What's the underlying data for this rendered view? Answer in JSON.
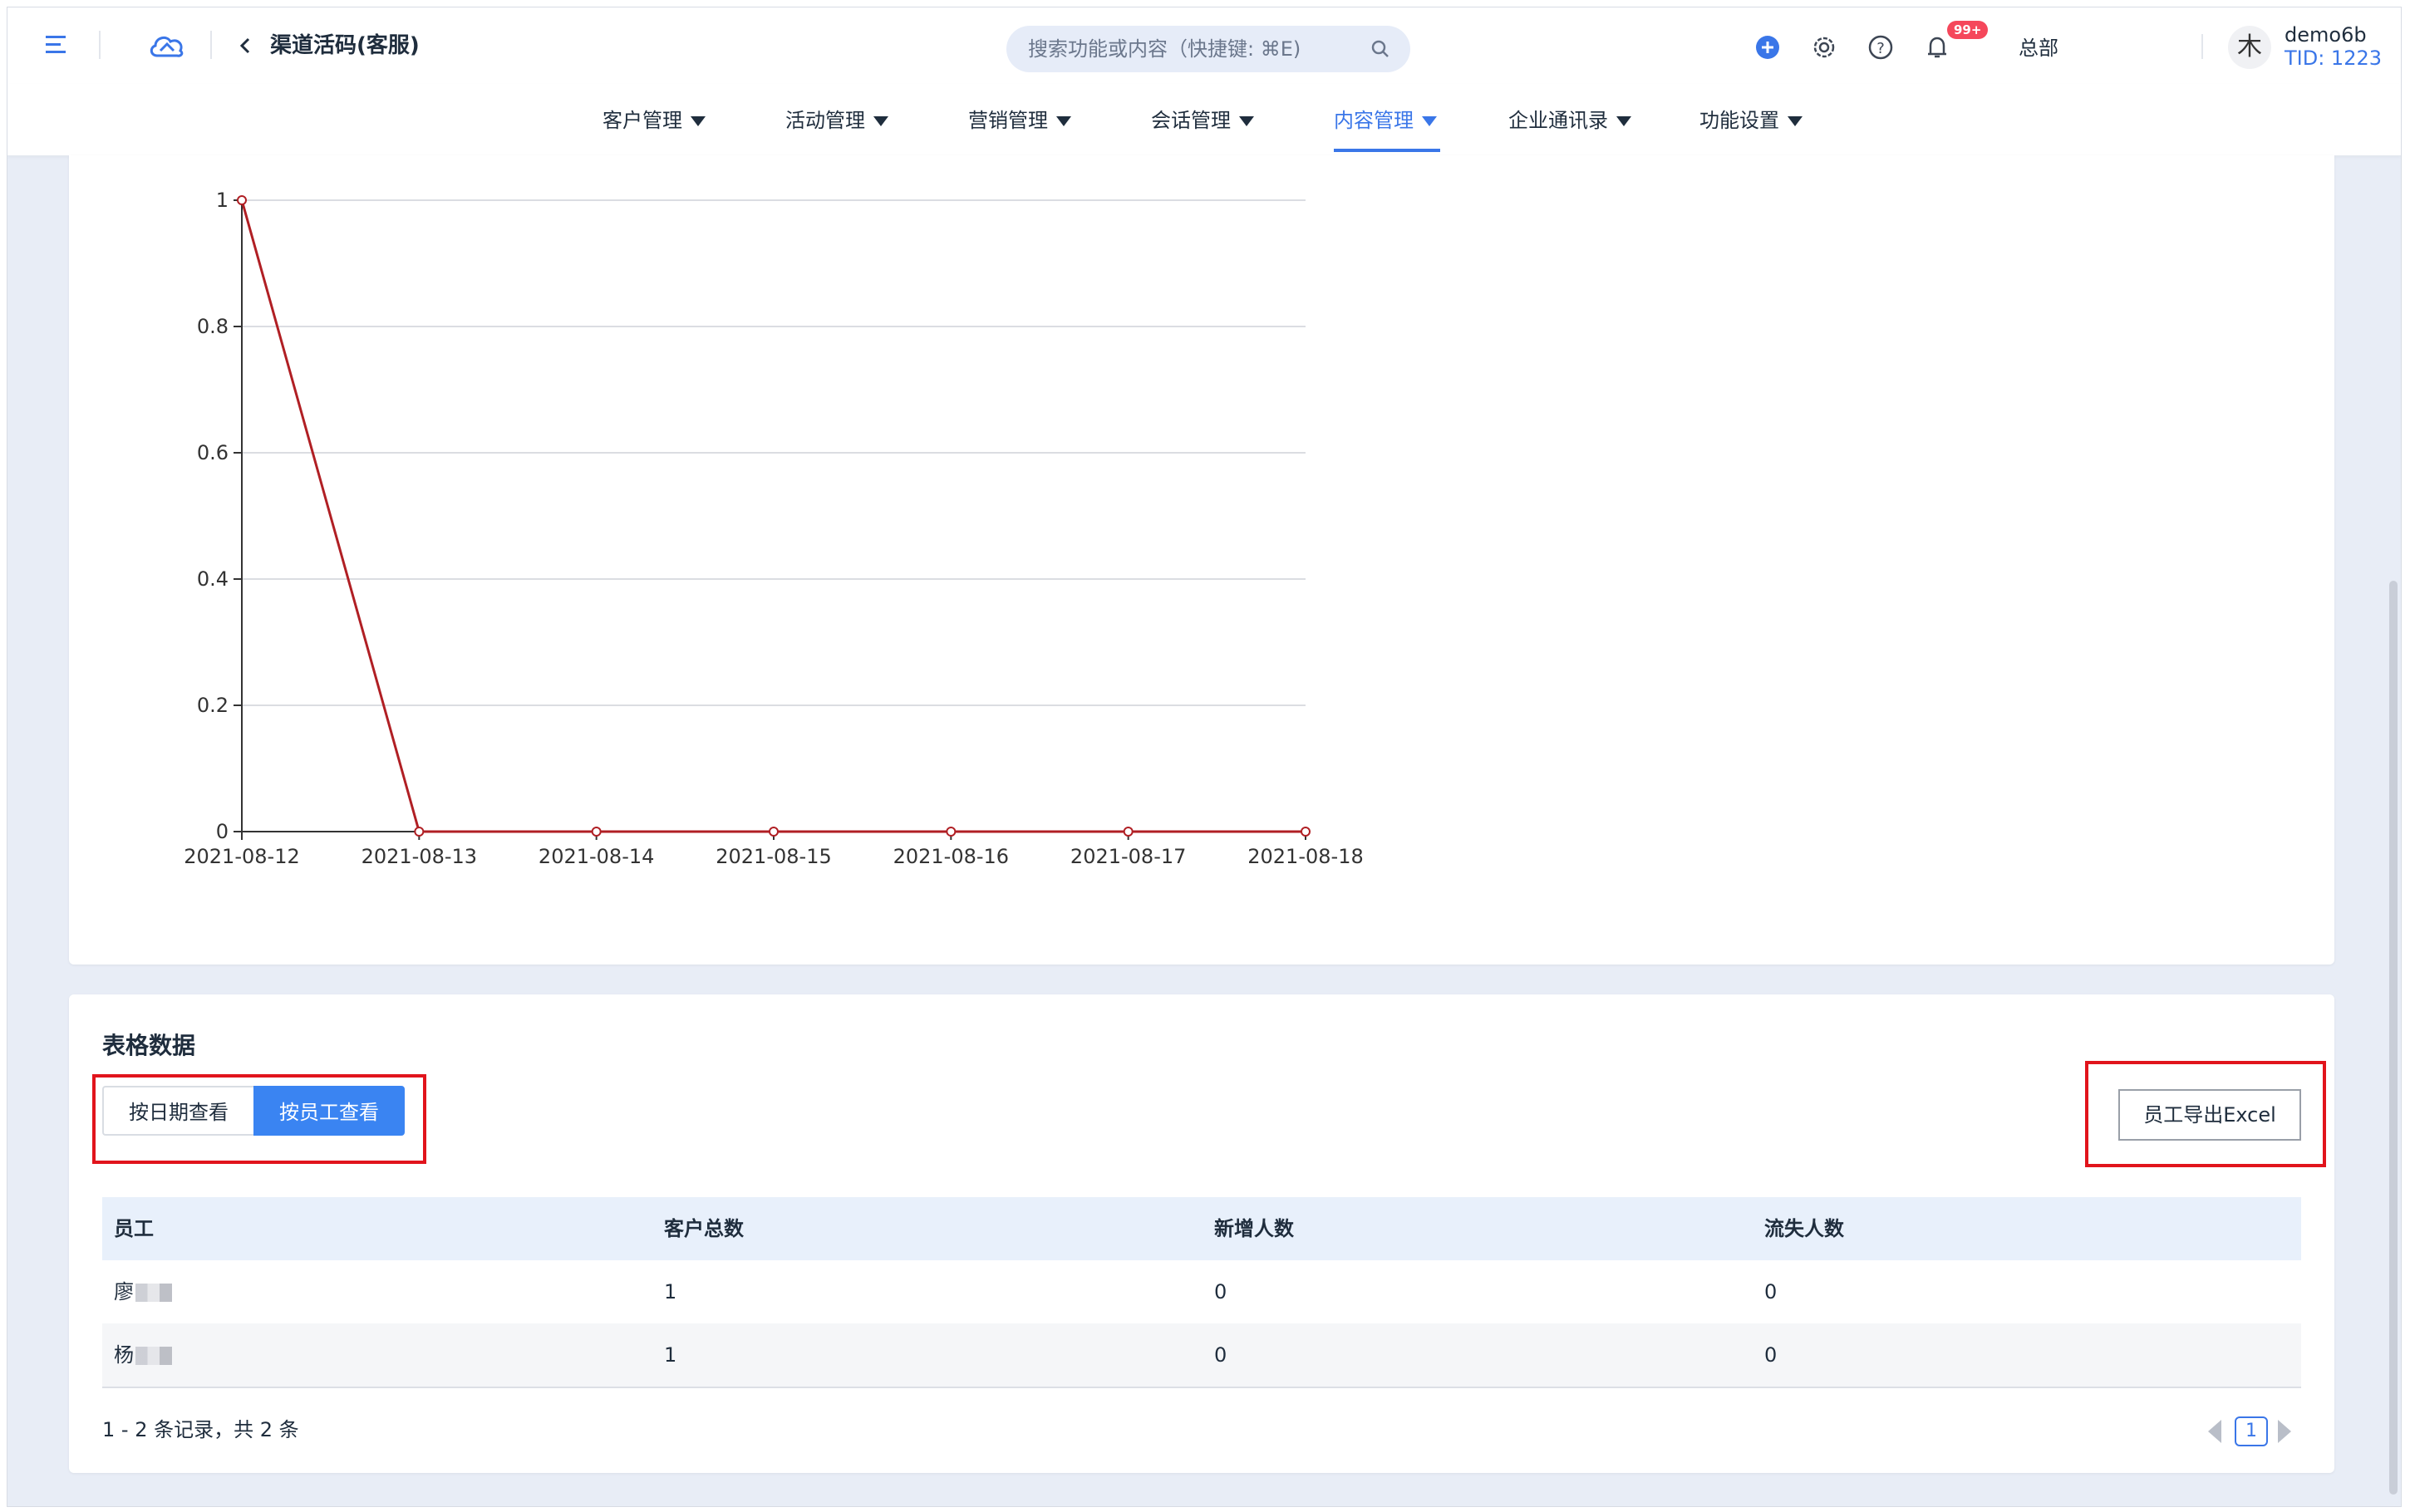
{
  "topbar": {
    "page_title": "渠道活码(客服)",
    "search_placeholder": "搜索功能或内容（快捷键: ⌘E)",
    "notification_badge": "99+",
    "org": "总部",
    "avatar_char": "木",
    "user_name": "demo6b",
    "tid": "TID: 1223",
    "accent": "#3a76e8"
  },
  "nav": {
    "items": [
      {
        "label": "客户管理"
      },
      {
        "label": "活动管理"
      },
      {
        "label": "营销管理"
      },
      {
        "label": "会话管理"
      },
      {
        "label": "内容管理"
      },
      {
        "label": "企业通讯录"
      },
      {
        "label": "功能设置"
      }
    ],
    "active": "内容管理"
  },
  "chart_data": {
    "type": "line",
    "x": [
      "2021-08-12",
      "2021-08-13",
      "2021-08-14",
      "2021-08-15",
      "2021-08-16",
      "2021-08-17",
      "2021-08-18"
    ],
    "series": [
      {
        "values": [
          1,
          0,
          0,
          0,
          0,
          0,
          0
        ],
        "color": "#b01f24"
      }
    ],
    "ylim": [
      0,
      1
    ],
    "yticks": [
      "0",
      "0.2",
      "0.4",
      "0.6",
      "0.8",
      "1"
    ],
    "grid": true
  },
  "table": {
    "title": "表格数据",
    "view_by_date": "按日期查看",
    "view_by_employee": "按员工查看",
    "export_label": "员工导出Excel",
    "columns": [
      "员工",
      "客户总数",
      "新增人数",
      "流失人数"
    ],
    "rows": [
      {
        "employee": "廖",
        "total": "1",
        "new": "0",
        "lost": "0"
      },
      {
        "employee": "杨",
        "total": "1",
        "new": "0",
        "lost": "0"
      }
    ],
    "summary": "1 - 2 条记录，共 2 条",
    "page": "1"
  }
}
